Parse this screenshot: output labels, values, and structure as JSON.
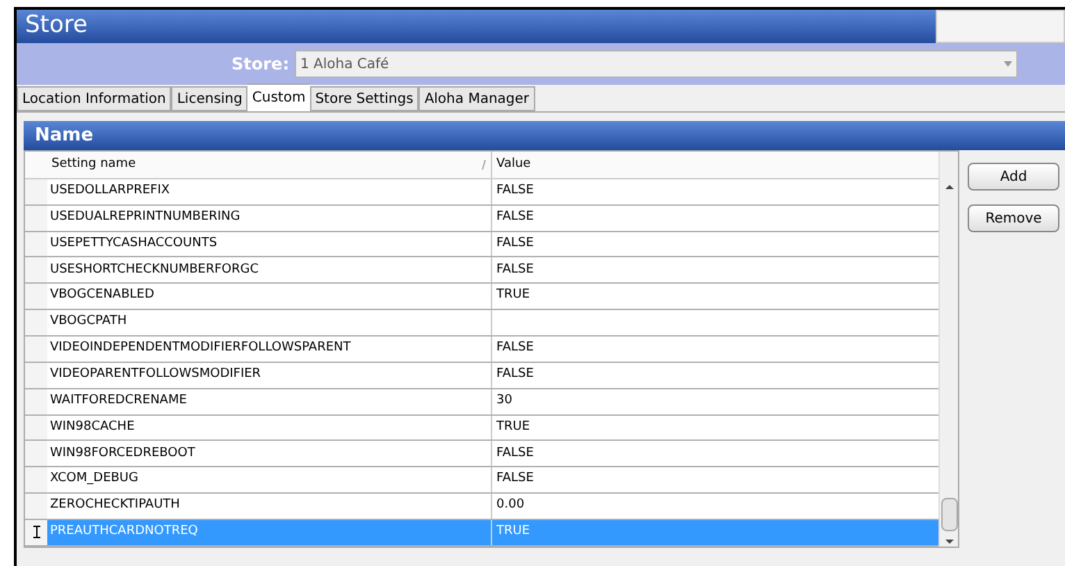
{
  "window": {
    "title": "Store"
  },
  "store_field": {
    "label": "Store:",
    "value": "1 Aloha Café"
  },
  "tabs": [
    {
      "label": "Location Information",
      "selected": false
    },
    {
      "label": "Licensing",
      "selected": false
    },
    {
      "label": "Custom",
      "selected": true
    },
    {
      "label": "Store Settings",
      "selected": false
    },
    {
      "label": "Aloha Manager",
      "selected": false
    }
  ],
  "section": {
    "title": "Name"
  },
  "table": {
    "columns": [
      "Setting name",
      "Value"
    ],
    "rows": [
      {
        "name": "USEDOLLARPREFIX",
        "value": "FALSE",
        "selected": false
      },
      {
        "name": "USEDUALREPRINTNUMBERING",
        "value": "FALSE",
        "selected": false
      },
      {
        "name": "USEPETTYCASHACCOUNTS",
        "value": "FALSE",
        "selected": false
      },
      {
        "name": "USESHORTCHECKNUMBERFORGC",
        "value": "FALSE",
        "selected": false
      },
      {
        "name": "VBOGCENABLED",
        "value": "TRUE",
        "selected": false
      },
      {
        "name": "VBOGCPATH",
        "selected": false
      },
      {
        "name": "VIDEOINDEPENDENTMODIFIERFOLLOWSPARENT",
        "value": "FALSE",
        "selected": false
      },
      {
        "name": "VIDEOPARENTFOLLOWSMODIFIER",
        "value": "FALSE",
        "selected": false
      },
      {
        "name": "WAITFOREDCRENAME",
        "value": "30",
        "selected": false
      },
      {
        "name": "WIN98CACHE",
        "value": "TRUE",
        "selected": false
      },
      {
        "name": "WIN98FORCEDREBOOT",
        "value": "FALSE",
        "selected": false
      },
      {
        "name": "XCOM_DEBUG",
        "value": "FALSE",
        "selected": false
      },
      {
        "name": "ZEROCHECKTIPAUTH",
        "value": "0.00",
        "selected": false
      },
      {
        "name": "PREAUTHCARDNOTREQ",
        "value": "TRUE",
        "selected": true
      }
    ]
  },
  "buttons": [
    "Add",
    "Remove"
  ]
}
